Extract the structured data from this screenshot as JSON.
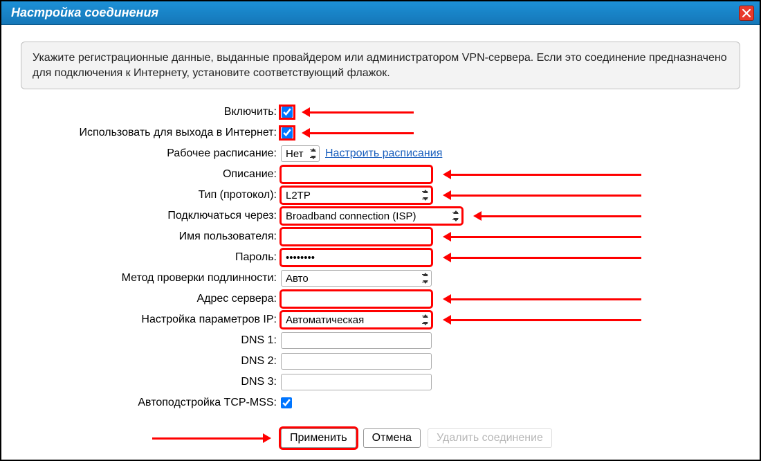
{
  "titlebar": {
    "title": "Настройка соединения"
  },
  "infobox": "Укажите регистрационные данные, выданные провайдером или администратором VPN-сервера. Если это соединение предназначено для подключения к Интернету, установите соответствующий флажок.",
  "labels": {
    "enable": "Включить:",
    "use_internet": "Использовать для выхода в Интернет:",
    "schedule": "Рабочее расписание:",
    "schedule_link": "Настроить расписания",
    "description": "Описание:",
    "type": "Тип (протокол):",
    "via": "Подключаться через:",
    "username": "Имя пользователя:",
    "password": "Пароль:",
    "auth": "Метод проверки подлинности:",
    "server": "Адрес сервера:",
    "ip_setup": "Настройка параметров IP:",
    "dns1": "DNS 1:",
    "dns2": "DNS 2:",
    "dns3": "DNS 3:",
    "tcpmss": "Автоподстройка TCP-MSS:"
  },
  "values": {
    "enable_checked": true,
    "use_internet_checked": true,
    "schedule": "Нет",
    "description": "",
    "type": "L2TP",
    "via": "Broadband connection (ISP)",
    "username": "",
    "password": "••••••••",
    "auth": "Авто",
    "server": "",
    "ip_setup": "Автоматическая",
    "dns1": "",
    "dns2": "",
    "dns3": "",
    "tcpmss_checked": true
  },
  "buttons": {
    "apply": "Применить",
    "cancel": "Отмена",
    "delete": "Удалить соединение"
  },
  "colors": {
    "accent_red": "#ff0000",
    "titlebar_blue": "#1c90d7"
  }
}
